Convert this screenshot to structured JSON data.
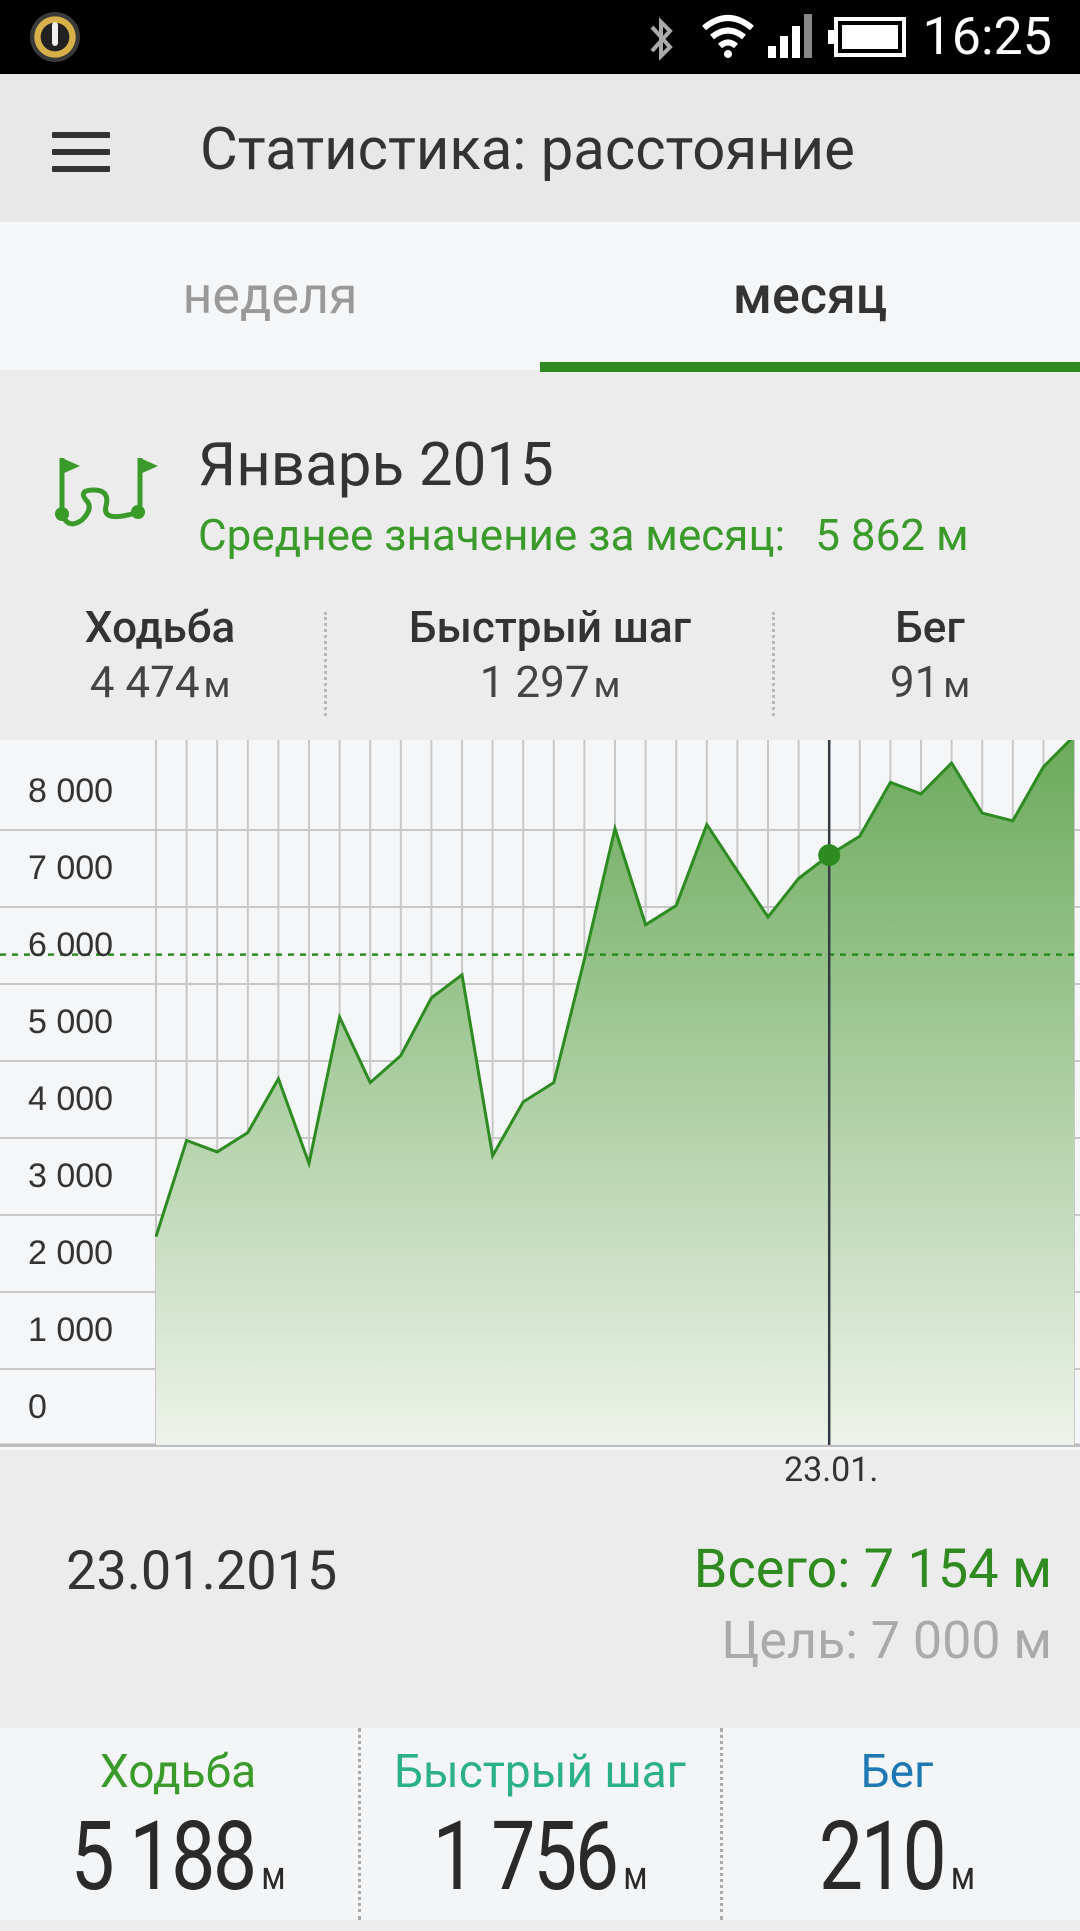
{
  "status_bar": {
    "time": "16:25",
    "icons": [
      "app-power-icon",
      "bluetooth-icon",
      "wifi-icon",
      "signal-icon",
      "battery-icon"
    ]
  },
  "app_bar": {
    "title": "Статистика: расстояние",
    "menu_icon": "hamburger-menu-icon"
  },
  "tabs": [
    {
      "label": "неделя",
      "active": false
    },
    {
      "label": "месяц",
      "active": true
    }
  ],
  "month": {
    "title": "Январь 2015",
    "average_label": "Среднее значение за месяц:",
    "average_value": "5 862 м",
    "icon": "route-flags-icon"
  },
  "summary": [
    {
      "label": "Ходьба",
      "value": "4 474",
      "unit": "м"
    },
    {
      "label": "Быстрый шаг",
      "value": "1 297",
      "unit": "м"
    },
    {
      "label": "Бег",
      "value": "91",
      "unit": "м"
    }
  ],
  "chart_data": {
    "type": "area",
    "x_tick_label": "23.01.",
    "yticks": [
      "0",
      "1 000",
      "2 000",
      "3 000",
      "4 000",
      "5 000",
      "6 000",
      "7 000",
      "8 000"
    ],
    "ylim": [
      0,
      8500
    ],
    "x": [
      1,
      2,
      3,
      4,
      5,
      6,
      7,
      8,
      9,
      10,
      11,
      12,
      13,
      14,
      15,
      16,
      17,
      18,
      19,
      20,
      21,
      22,
      23,
      24,
      25,
      26,
      27,
      28,
      29,
      30,
      31
    ],
    "values": [
      2200,
      3450,
      3300,
      3550,
      4250,
      3150,
      5050,
      4200,
      4550,
      5300,
      5600,
      3250,
      3950,
      4200,
      5800,
      7500,
      6250,
      6500,
      7550,
      6950,
      6350,
      6850,
      7154,
      7400,
      8100,
      7950,
      8350,
      7700,
      7600,
      8300,
      8700
    ],
    "average_line": 5862,
    "selected_x": 23,
    "colors": {
      "line": "#2e8b22",
      "fill_top": "#6aaa5a",
      "fill_bottom": "#eef3ea",
      "grid": "#c8c8c8"
    }
  },
  "detail": {
    "date": "23.01.2015",
    "total": "Всего: 7 154 м",
    "goal": "Цель: 7 000 м"
  },
  "bottom": [
    {
      "label": "Ходьба",
      "value": "5 188",
      "unit": "м",
      "color": "#3a9a2a"
    },
    {
      "label": "Быстрый шаг",
      "value": "1 756",
      "unit": "м",
      "color": "#2bb08a"
    },
    {
      "label": "Бег",
      "value": "210",
      "unit": "м",
      "color": "#1f78b4"
    }
  ]
}
